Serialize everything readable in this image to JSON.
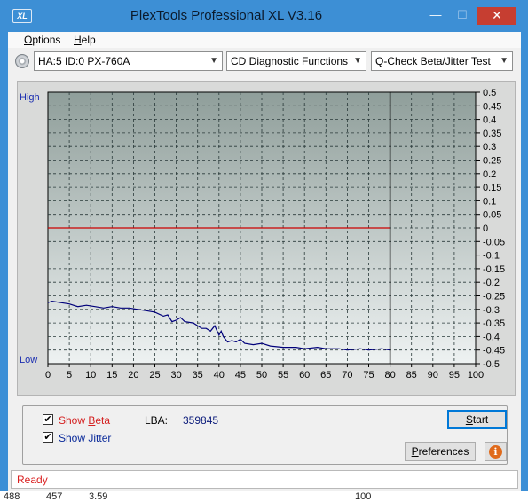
{
  "window": {
    "title": "PlexTools Professional XL V3.16",
    "logo": "XL",
    "minimize_glyph": "—",
    "maximize_glyph": "☐",
    "close_glyph": "✕"
  },
  "menu": {
    "options_label": "Options",
    "options_key": "O",
    "options_rest": "ptions",
    "help_label": "Help",
    "help_key": "H",
    "help_rest": "elp"
  },
  "toolbar": {
    "drive_icon": "optical-drive-icon",
    "drive_value": "HA:5 ID:0  PX-760A",
    "function_value": "CD Diagnostic Functions",
    "test_value": "Q-Check Beta/Jitter Test"
  },
  "chart_data": {
    "type": "line",
    "x_ticks": [
      0,
      5,
      10,
      15,
      20,
      25,
      30,
      35,
      40,
      45,
      50,
      55,
      60,
      65,
      70,
      75,
      80,
      85,
      90,
      95,
      100
    ],
    "xlim": [
      0,
      100
    ],
    "right_ticks": [
      "0.5",
      "0.45",
      "0.4",
      "0.35",
      "0.3",
      "0.25",
      "0.2",
      "0.15",
      "0.1",
      "0.05",
      "0",
      "-0.05",
      "-0.1",
      "-0.15",
      "-0.2",
      "-0.25",
      "-0.3",
      "-0.35",
      "-0.4",
      "-0.45",
      "-0.5"
    ],
    "ylim": [
      -0.5,
      0.5
    ],
    "left_top_label": "High",
    "left_bottom_label": "Low",
    "grid": true,
    "end_marker_x": 80,
    "background_top": "#8f9e9a",
    "background_bottom": "#eef2f2",
    "series": [
      {
        "color": "#cc0000",
        "points": [
          [
            0,
            0.0
          ],
          [
            5,
            0.0
          ],
          [
            10,
            0.0
          ],
          [
            15,
            0.0
          ],
          [
            20,
            0.0
          ],
          [
            25,
            0.0
          ],
          [
            30,
            0.0
          ],
          [
            35,
            0.0
          ],
          [
            40,
            0.0
          ],
          [
            45,
            0.0
          ],
          [
            50,
            0.0
          ],
          [
            55,
            0.0
          ],
          [
            60,
            0.0
          ],
          [
            65,
            0.0
          ],
          [
            70,
            0.0
          ],
          [
            75,
            0.0
          ],
          [
            80,
            0.0
          ]
        ]
      },
      {
        "color": "#00007a",
        "points": [
          [
            0,
            -0.275
          ],
          [
            1,
            -0.27
          ],
          [
            3,
            -0.275
          ],
          [
            5,
            -0.28
          ],
          [
            7,
            -0.29
          ],
          [
            9,
            -0.285
          ],
          [
            11,
            -0.29
          ],
          [
            13,
            -0.295
          ],
          [
            15,
            -0.29
          ],
          [
            17,
            -0.295
          ],
          [
            19,
            -0.295
          ],
          [
            21,
            -0.3
          ],
          [
            23,
            -0.305
          ],
          [
            25,
            -0.31
          ],
          [
            27,
            -0.325
          ],
          [
            28,
            -0.32
          ],
          [
            29,
            -0.345
          ],
          [
            30,
            -0.34
          ],
          [
            31,
            -0.33
          ],
          [
            32,
            -0.345
          ],
          [
            34,
            -0.35
          ],
          [
            35,
            -0.36
          ],
          [
            36,
            -0.37
          ],
          [
            37,
            -0.37
          ],
          [
            38,
            -0.38
          ],
          [
            39,
            -0.36
          ],
          [
            40,
            -0.395
          ],
          [
            40.5,
            -0.38
          ],
          [
            41,
            -0.4
          ],
          [
            42,
            -0.42
          ],
          [
            43,
            -0.415
          ],
          [
            44,
            -0.42
          ],
          [
            45,
            -0.41
          ],
          [
            46,
            -0.425
          ],
          [
            48,
            -0.43
          ],
          [
            50,
            -0.425
          ],
          [
            52,
            -0.435
          ],
          [
            55,
            -0.44
          ],
          [
            58,
            -0.44
          ],
          [
            60,
            -0.445
          ],
          [
            63,
            -0.44
          ],
          [
            65,
            -0.445
          ],
          [
            68,
            -0.445
          ],
          [
            70,
            -0.45
          ],
          [
            73,
            -0.445
          ],
          [
            75,
            -0.45
          ],
          [
            78,
            -0.445
          ],
          [
            80,
            -0.45
          ]
        ]
      }
    ]
  },
  "controls": {
    "show_beta_label": "Show Beta",
    "show_beta_prefix": "Show ",
    "show_beta_key": "B",
    "show_beta_rest": "eta",
    "show_beta_checked": true,
    "show_jitter_label": "Show Jitter",
    "show_jitter_prefix": "Show ",
    "show_jitter_key": "J",
    "show_jitter_rest": "itter",
    "show_jitter_checked": true,
    "lba_label": "LBA:",
    "lba_value": "359845",
    "start_label": "Start",
    "start_key": "S",
    "start_rest": "tart",
    "preferences_label": "Preferences",
    "preferences_key": "P",
    "preferences_rest": "references",
    "info_icon": "info-icon",
    "info_glyph": "i",
    "check_glyph": "✔"
  },
  "status": {
    "text": "Ready",
    "color": "#d92020"
  },
  "background_strip": {
    "left_values": [
      "488",
      "457",
      "3.59"
    ],
    "right_value": "100"
  }
}
